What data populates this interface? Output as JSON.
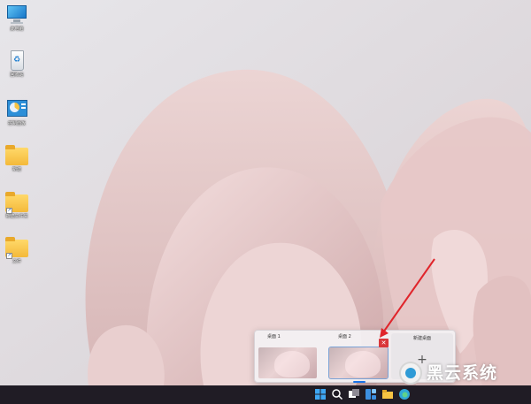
{
  "desktop": {
    "icons": [
      {
        "label": "此电脑",
        "icon": "monitor-icon"
      },
      {
        "label": "回收站",
        "icon": "recycle-bin-icon"
      },
      {
        "label": "控制面板",
        "icon": "control-panel-icon"
      },
      {
        "label": "新建",
        "icon": "folder-icon"
      },
      {
        "label": "新建文件夹",
        "icon": "folder-shortcut-icon"
      },
      {
        "label": "文件",
        "icon": "folder-shortcut-icon"
      }
    ]
  },
  "task_view": {
    "desktops": [
      {
        "label": "桌面 1"
      },
      {
        "label": "桌面 2",
        "active": true
      }
    ],
    "close_symbol": "✕",
    "new_desktop_label": "新建桌面",
    "new_desktop_symbol": "+"
  },
  "taskbar": {
    "icons": [
      "start-icon",
      "search-icon",
      "task-view-icon",
      "widgets-icon",
      "file-explorer-icon",
      "edge-icon"
    ]
  },
  "watermark": {
    "text": "黑云系统"
  },
  "colors": {
    "taskbar": "#201c25",
    "close_button": "#d9373b",
    "annotation_arrow": "#e0252b",
    "accent": "#1a73e8"
  }
}
